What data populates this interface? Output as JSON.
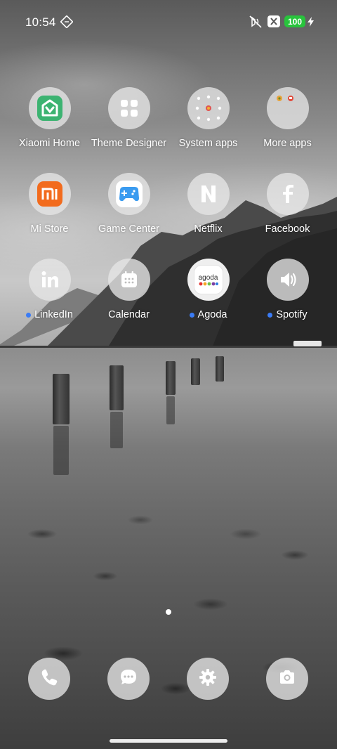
{
  "status_bar": {
    "time": "10:54",
    "battery_level": "100",
    "icons": [
      "nfc-icon",
      "silent-icon",
      "sim-off-icon",
      "battery-icon",
      "charging-icon"
    ]
  },
  "apps": [
    {
      "name": "xiaomi-home",
      "label": "Xiaomi Home",
      "icon": "xiaomi-home-icon",
      "new": false
    },
    {
      "name": "theme-designer",
      "label": "Theme Designer",
      "icon": "grid-icon",
      "new": false
    },
    {
      "name": "system-apps",
      "label": "System apps",
      "icon": "folder-icon",
      "new": false
    },
    {
      "name": "more-apps",
      "label": "More apps",
      "icon": "folder-icon",
      "new": false
    },
    {
      "name": "mi-store",
      "label": "Mi Store",
      "icon": "mi-logo-icon",
      "new": false
    },
    {
      "name": "game-center",
      "label": "Game Center",
      "icon": "gamepad-icon",
      "new": false
    },
    {
      "name": "netflix",
      "label": "Netflix",
      "icon": "netflix-icon",
      "new": false
    },
    {
      "name": "facebook",
      "label": "Facebook",
      "icon": "facebook-icon",
      "new": false
    },
    {
      "name": "linkedin",
      "label": "LinkedIn",
      "icon": "linkedin-icon",
      "new": true
    },
    {
      "name": "calendar",
      "label": "Calendar",
      "icon": "calendar-icon",
      "new": false
    },
    {
      "name": "agoda",
      "label": "Agoda",
      "icon": "agoda-icon",
      "logo_text": "agoda",
      "new": true
    },
    {
      "name": "spotify",
      "label": "Spotify",
      "icon": "speaker-icon",
      "new": true
    }
  ],
  "dock": [
    {
      "name": "phone",
      "icon": "phone-icon"
    },
    {
      "name": "messages",
      "icon": "message-icon"
    },
    {
      "name": "settings",
      "icon": "gear-icon"
    },
    {
      "name": "camera",
      "icon": "camera-icon"
    }
  ],
  "colors": {
    "xiaomi_home": "#3cb371",
    "mi_store": "#f26b1d",
    "game_center": "#3a9bf0",
    "battery": "#28c43c",
    "new_dot": "#3b7cf5"
  },
  "pages": {
    "current": 1,
    "total": 1
  }
}
